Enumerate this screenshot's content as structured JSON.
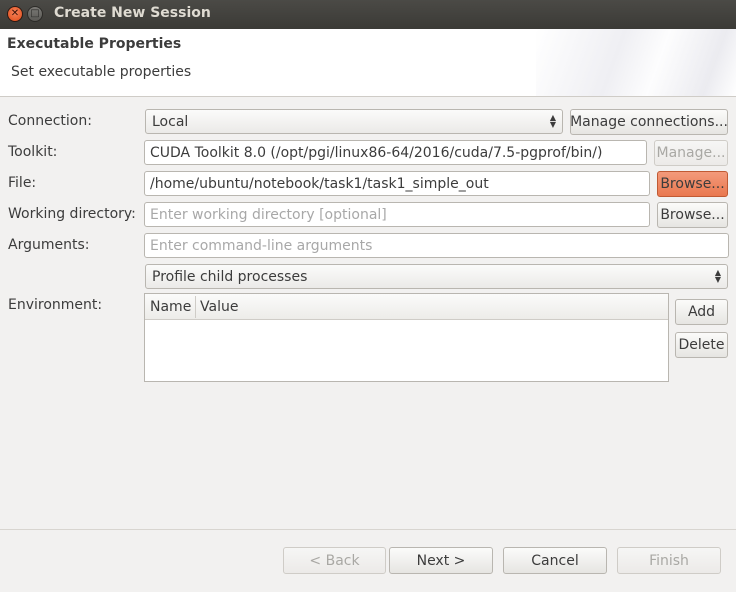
{
  "window": {
    "title": "Create New Session",
    "close_glyph": "✕",
    "maximize_glyph": "□"
  },
  "header": {
    "title": "Executable Properties",
    "subtitle": "Set executable properties"
  },
  "form": {
    "connection": {
      "label": "Connection:",
      "value": "Local",
      "manage_button": "Manage connections..."
    },
    "toolkit": {
      "label": "Toolkit:",
      "value": "CUDA Toolkit 8.0 (/opt/pgi/linux86-64/2016/cuda/7.5-pgprof/bin/)",
      "manage_button": "Manage..."
    },
    "file": {
      "label": "File:",
      "value": "/home/ubuntu/notebook/task1/task1_simple_out",
      "browse_button": "Browse..."
    },
    "working_directory": {
      "label": "Working directory:",
      "placeholder": "Enter working directory [optional]",
      "browse_button": "Browse..."
    },
    "arguments": {
      "label": "Arguments:",
      "placeholder": "Enter command-line arguments"
    },
    "profile_mode": {
      "value": "Profile child processes"
    },
    "environment": {
      "label": "Environment:",
      "columns": [
        "Name",
        "Value"
      ],
      "rows": [],
      "add_button": "Add",
      "delete_button": "Delete"
    }
  },
  "footer": {
    "back": "< Back",
    "next": "Next >",
    "cancel": "Cancel",
    "finish": "Finish"
  },
  "colors": {
    "titlebar": "#3b3a36",
    "close_button": "#df4a16",
    "focused_button": "#e9784f"
  },
  "icons": {
    "combo_arrow": "up-down-chevron-icon"
  }
}
